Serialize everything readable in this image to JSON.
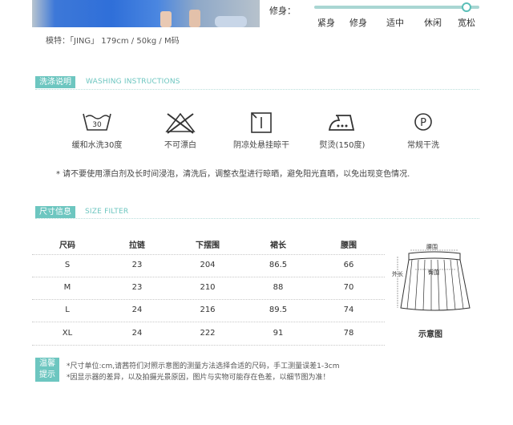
{
  "model_info": "模特：「JING」 179cm / 50kg / M码",
  "fit": {
    "label": "修身：",
    "options": [
      "紧身",
      "修身",
      "适中",
      "休闲",
      "宽松"
    ],
    "selected_index": 4
  },
  "washing": {
    "title_cn": "洗涤说明",
    "title_en": "WASHING INSTRUCTIONS",
    "items": [
      {
        "icon": "wash-30-icon",
        "label": "缓和水洗30度",
        "temp": "30"
      },
      {
        "icon": "no-bleach-icon",
        "label": "不可漂白"
      },
      {
        "icon": "line-dry-shade-icon",
        "label": "阴凉处悬挂晾干"
      },
      {
        "icon": "iron-icon",
        "label": "熨烫(150度)"
      },
      {
        "icon": "dry-clean-icon",
        "label": "常规干洗",
        "letter": "P"
      }
    ],
    "note": "* 请不要使用漂白剂及长时间浸泡，清洗后，调整衣型进行晾晒，避免阳光直晒，以免出现变色情况."
  },
  "size": {
    "title_cn": "尺寸信息",
    "title_en": "SIZE FILTER",
    "headers": [
      "尺码",
      "拉链",
      "下摆围",
      "裙长",
      "腰围"
    ],
    "rows": [
      [
        "S",
        "23",
        "204",
        "86.5",
        "66"
      ],
      [
        "M",
        "23",
        "210",
        "88",
        "70"
      ],
      [
        "L",
        "24",
        "216",
        "89.5",
        "74"
      ],
      [
        "XL",
        "24",
        "222",
        "91",
        "78"
      ]
    ],
    "diagram": {
      "waist": "腰围",
      "hip": "臀围",
      "outer_length": "外长",
      "caption": "示意图"
    }
  },
  "tips": {
    "title_line1": "温馨",
    "title_line2": "提示",
    "line1": "*尺寸单位:cm,请茜符们对照示意图的测量方法选择合适的尺码，手工测量误差1-3cm",
    "line2": "*因显示器的差异，以及拍摄光景原因，图片与实物可能存在色差，以细节图为准！"
  },
  "colors": {
    "accent": "#6dc6c0",
    "accent_light": "#a9d6d3"
  }
}
